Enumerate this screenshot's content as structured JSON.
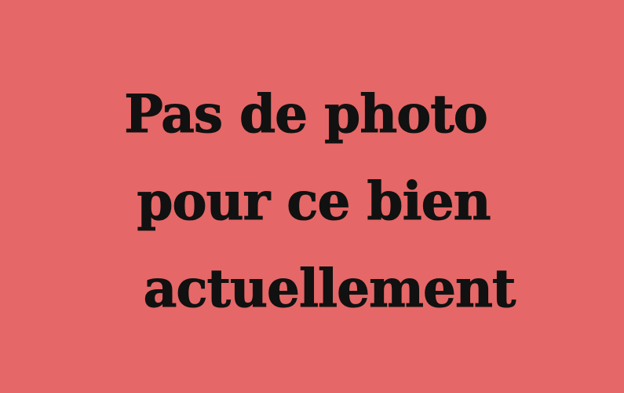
{
  "placeholder": {
    "background_color": "#e66767",
    "text_color": "#111111",
    "lines": [
      "Pas de photo",
      "pour ce bien",
      "actuellement"
    ]
  }
}
